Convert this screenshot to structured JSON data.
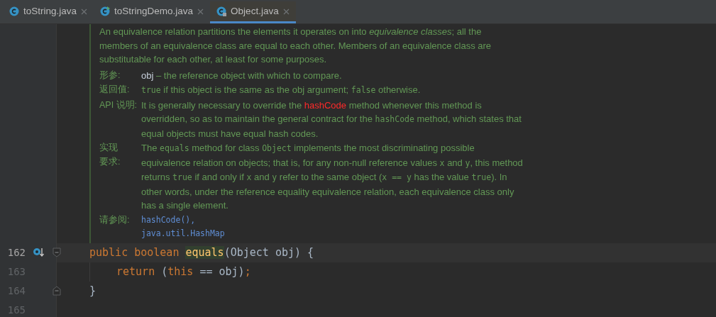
{
  "tabs": [
    {
      "label": "toString.java",
      "selected": false,
      "kind": "class"
    },
    {
      "label": "toStringDemo.java",
      "selected": false,
      "kind": "runnable"
    },
    {
      "label": "Object.java",
      "selected": true,
      "kind": "locked"
    }
  ],
  "doc": {
    "intro": [
      {
        "kind": "text",
        "text": "An equivalence relation partitions the elements it operates on into "
      },
      {
        "kind": "italic",
        "text": "equivalence classes"
      },
      {
        "kind": "text",
        "text": "; all the members of an equivalence class are equal to each other. Members of an equivalence class are substitutable for each other, at least for some purposes."
      }
    ],
    "sections": [
      {
        "label": [
          "形参:"
        ],
        "segments": [
          {
            "kind": "param",
            "text": "obj"
          },
          {
            "kind": "text",
            "text": " – the reference object with which to compare."
          }
        ]
      },
      {
        "label": [
          "返回值:"
        ],
        "segments": [
          {
            "kind": "code",
            "text": "true"
          },
          {
            "kind": "text",
            "text": " if this object is the same as the obj argument; "
          },
          {
            "kind": "code",
            "text": "false"
          },
          {
            "kind": "text",
            "text": " otherwise."
          }
        ]
      },
      {
        "label": [
          "API 说明:"
        ],
        "segments": [
          {
            "kind": "text",
            "text": "It is generally necessary to override the "
          },
          {
            "kind": "error",
            "text": "hashCode"
          },
          {
            "kind": "text",
            "text": " method whenever this method is overridden, so as to maintain the general contract for the "
          },
          {
            "kind": "code",
            "text": "hashCode"
          },
          {
            "kind": "text",
            "text": " method, which states that equal objects must have equal hash codes."
          }
        ]
      },
      {
        "label": [
          "实现",
          "要求:"
        ],
        "segments": [
          {
            "kind": "text",
            "text": "The "
          },
          {
            "kind": "code",
            "text": "equals"
          },
          {
            "kind": "text",
            "text": " method for class "
          },
          {
            "kind": "code",
            "text": "Object"
          },
          {
            "kind": "text",
            "text": " implements the most discriminating possible equivalence relation on objects; that is, for any non-null reference values "
          },
          {
            "kind": "code",
            "text": "x"
          },
          {
            "kind": "text",
            "text": " and "
          },
          {
            "kind": "code",
            "text": "y"
          },
          {
            "kind": "text",
            "text": ", this method returns "
          },
          {
            "kind": "code",
            "text": "true"
          },
          {
            "kind": "text",
            "text": " if and only if "
          },
          {
            "kind": "code",
            "text": "x"
          },
          {
            "kind": "text",
            "text": " and "
          },
          {
            "kind": "code",
            "text": "y"
          },
          {
            "kind": "text",
            "text": " refer to the same object ("
          },
          {
            "kind": "code",
            "text": "x == y"
          },
          {
            "kind": "text",
            "text": " has the value "
          },
          {
            "kind": "code",
            "text": "true"
          },
          {
            "kind": "text",
            "text": "). In other words, under the reference equality equivalence relation, each equivalence class only has a single element."
          }
        ]
      },
      {
        "label": [
          "请参阅:"
        ],
        "links": [
          "hashCode(),",
          "java.util.HashMap"
        ]
      }
    ]
  },
  "lines": [
    {
      "number": "162",
      "current": true,
      "marker": true,
      "fold_marker": true,
      "tokens": [
        {
          "kind": "keyword",
          "text": "public boolean "
        },
        {
          "kind": "method",
          "text": "equals"
        },
        {
          "kind": "plain",
          "text": "(Object obj) {"
        }
      ],
      "children": [
        {
          "number": "163",
          "current": false,
          "marker": false,
          "fold_marker": false,
          "tokens": [
            {
              "kind": "keyword",
              "text": "return "
            },
            {
              "kind": "plain",
              "text": "("
            },
            {
              "kind": "keyword",
              "text": "this"
            },
            {
              "kind": "plain",
              "text": " == obj)"
            },
            {
              "kind": "keyword",
              "text": ";"
            }
          ]
        }
      ]
    },
    {
      "number": "164",
      "current": false,
      "marker": false,
      "fold_marker": true,
      "tokens": [
        {
          "kind": "plain",
          "text": "}"
        }
      ]
    },
    {
      "number": "165",
      "current": false,
      "marker": false,
      "fold_marker": false
    }
  ]
}
